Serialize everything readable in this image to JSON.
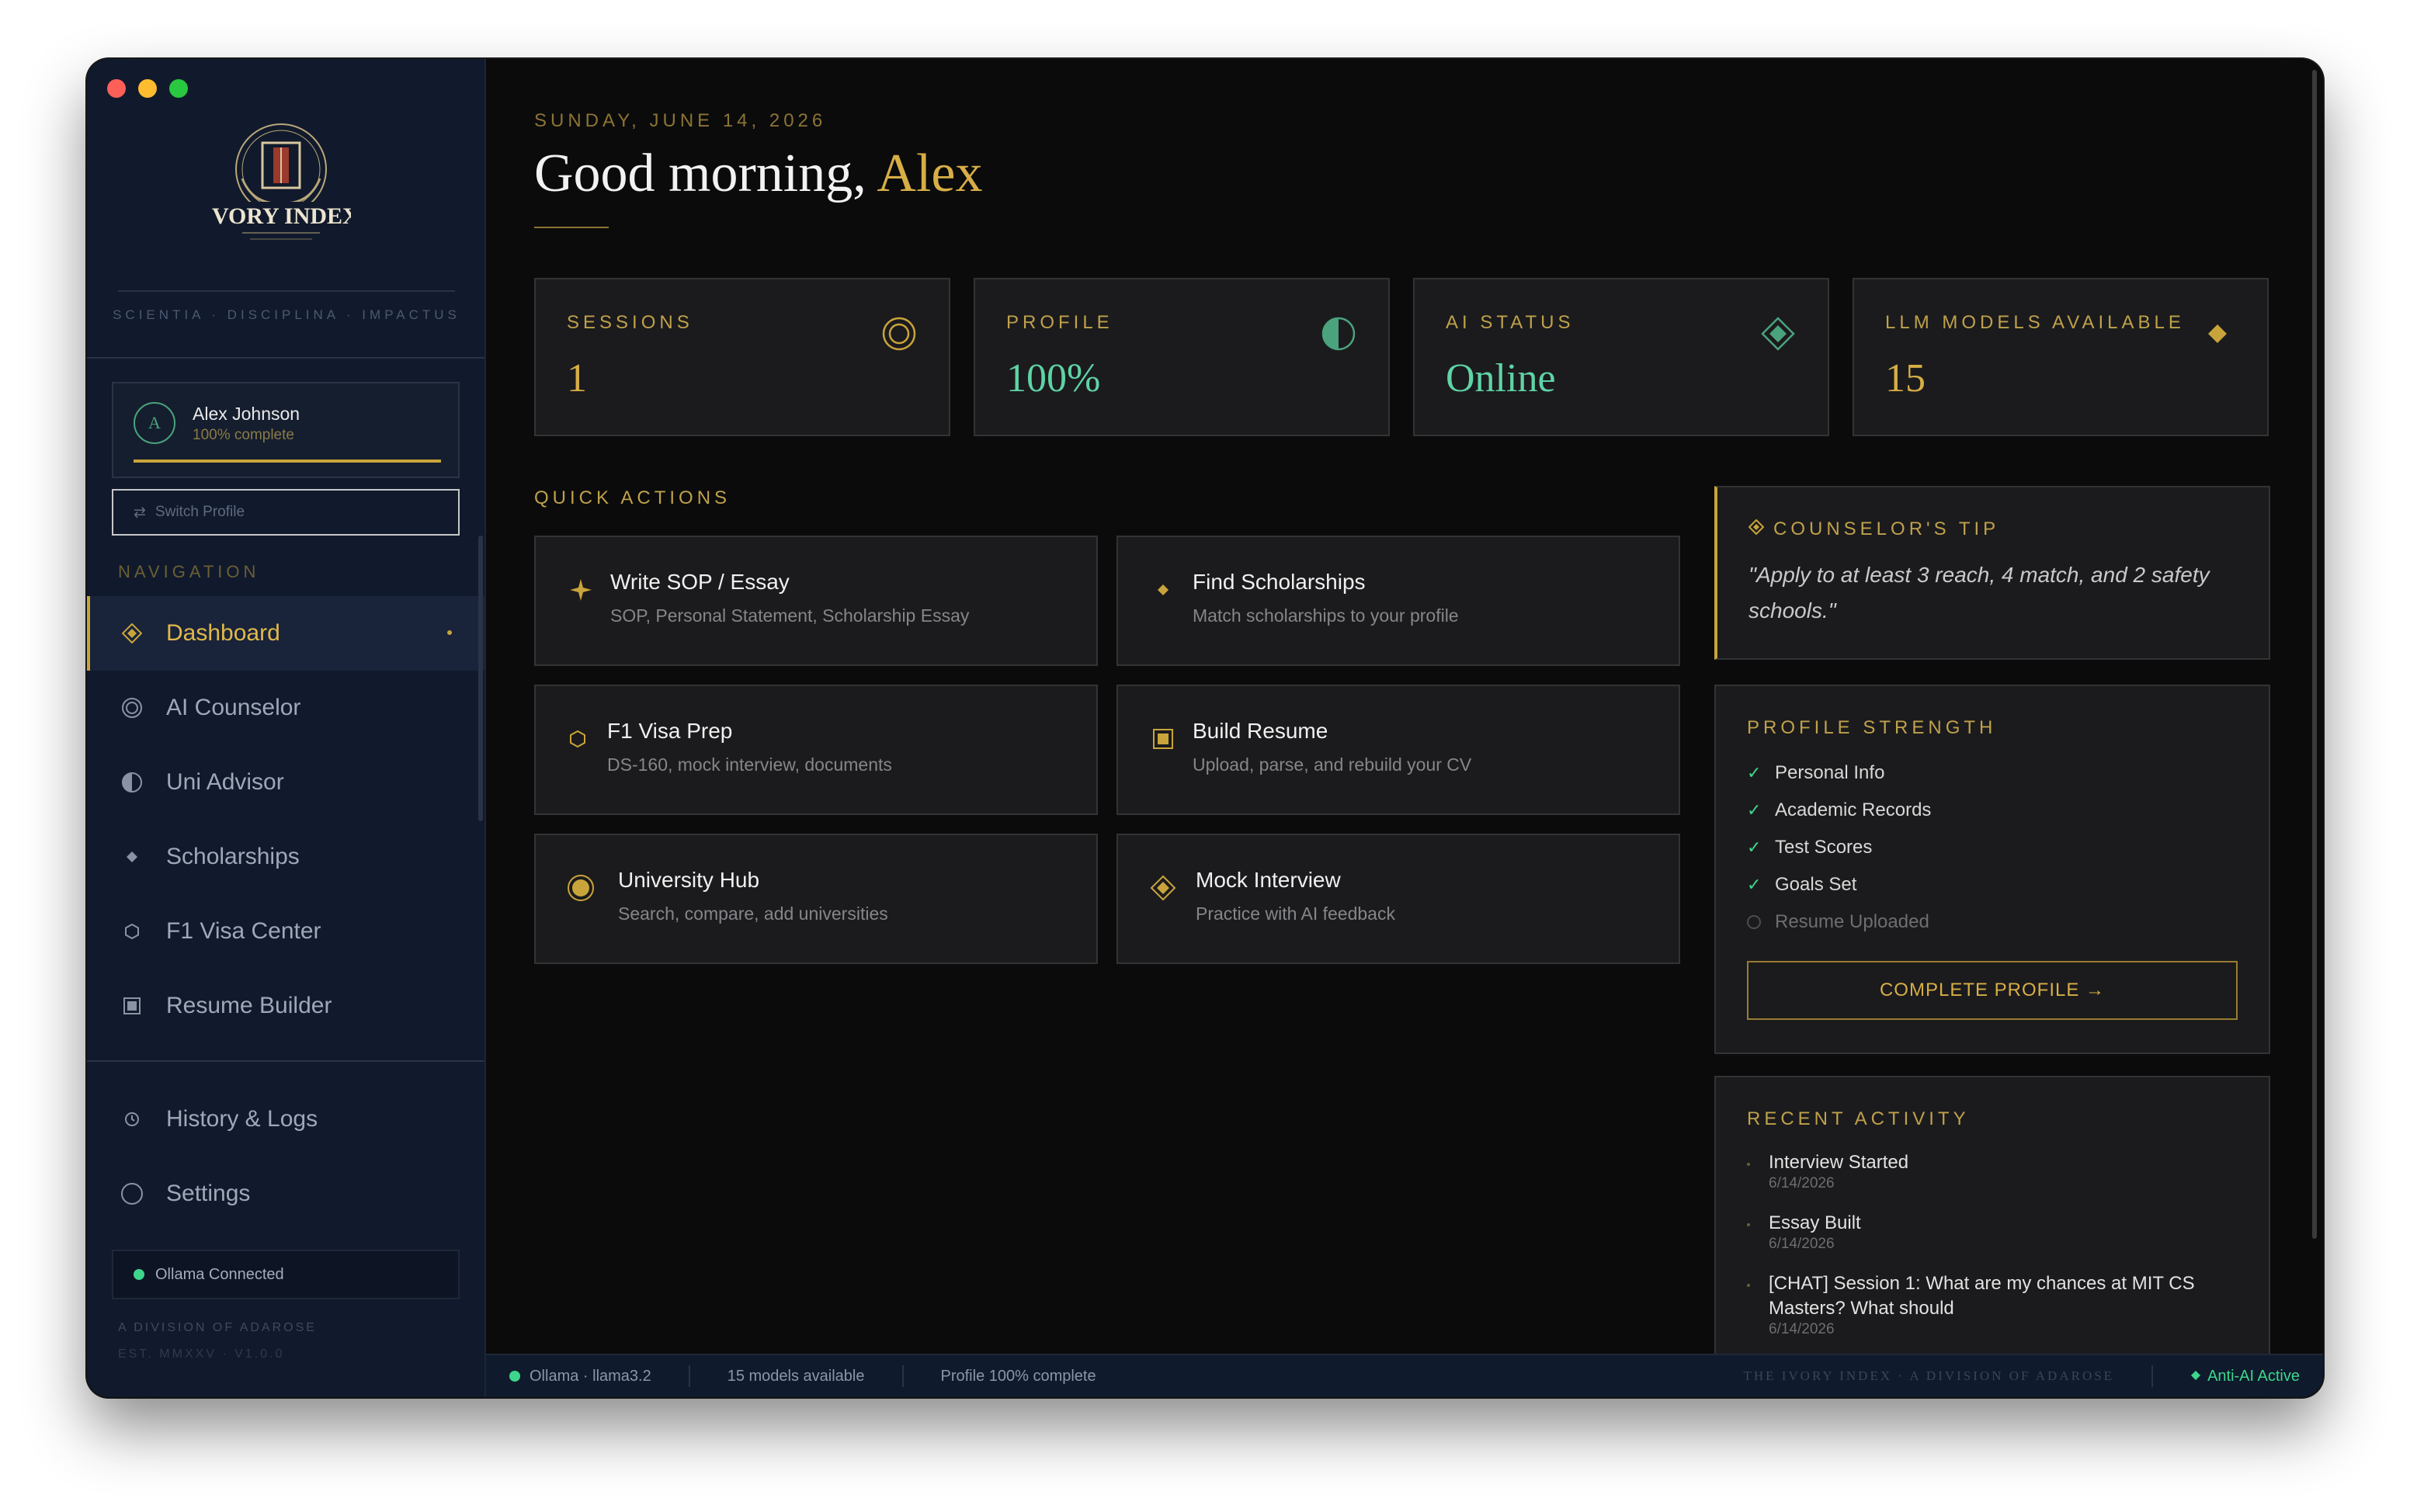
{
  "sidebar": {
    "motto": "SCIENTIA · DISCIPLINA · IMPACTUS",
    "profile": {
      "initial": "A",
      "name": "Alex Johnson",
      "progress_text": "100% complete",
      "progress": 1.0
    },
    "switch_profile": "Switch Profile",
    "nav_title": "NAVIGATION",
    "nav_items": [
      {
        "label": "Dashboard",
        "icon": "diamond-icon",
        "active": true
      },
      {
        "label": "AI Counselor",
        "icon": "ring-icon"
      },
      {
        "label": "Uni Advisor",
        "icon": "half-circle-icon"
      },
      {
        "label": "Scholarships",
        "icon": "small-diamond-icon"
      },
      {
        "label": "F1 Visa Center",
        "icon": "hexagon-icon"
      },
      {
        "label": "Resume Builder",
        "icon": "square-icon"
      }
    ],
    "bottom_items": [
      {
        "label": "History & Logs",
        "icon": "clock-icon"
      },
      {
        "label": "Settings",
        "icon": "circle-icon"
      }
    ],
    "ollama_status": "Ollama Connected",
    "division": "A DIVISION OF ADAROSE",
    "est": "EST. MMXXV · V1.0.0"
  },
  "header": {
    "date": "SUNDAY, JUNE 14, 2026",
    "greeting": "Good morning, ",
    "name": "Alex"
  },
  "stats": [
    {
      "label": "SESSIONS",
      "value": "1",
      "icon": "ring-icon"
    },
    {
      "label": "PROFILE",
      "value": "100%",
      "icon": "half-circle-icon"
    },
    {
      "label": "AI STATUS",
      "value": "Online",
      "icon": "diamond-icon"
    },
    {
      "label": "LLM MODELS AVAILABLE",
      "value": "15",
      "icon": "small-diamond-icon"
    }
  ],
  "quick_actions": {
    "title": "QUICK ACTIONS",
    "items": [
      {
        "name": "Write SOP / Essay",
        "desc": "SOP, Personal Statement, Scholarship Essay",
        "icon": "sparkle-icon"
      },
      {
        "name": "Find Scholarships",
        "desc": "Match scholarships to your profile",
        "icon": "small-diamond-icon"
      },
      {
        "name": "F1 Visa Prep",
        "desc": "DS-160, mock interview, documents",
        "icon": "hexagon-icon"
      },
      {
        "name": "Build Resume",
        "desc": "Upload, parse, and rebuild your CV",
        "icon": "square-icon"
      },
      {
        "name": "University Hub",
        "desc": "Search, compare, add universities",
        "icon": "ring-icon"
      },
      {
        "name": "Mock Interview",
        "desc": "Practice with AI feedback",
        "icon": "diamond-icon"
      }
    ]
  },
  "tip": {
    "title": "COUNSELOR'S TIP",
    "text": "\"Apply to at least 3 reach, 4 match, and 2 safety schools.\""
  },
  "profile_strength": {
    "title": "PROFILE STRENGTH",
    "items": [
      {
        "label": "Personal Info",
        "done": true
      },
      {
        "label": "Academic Records",
        "done": true
      },
      {
        "label": "Test Scores",
        "done": true
      },
      {
        "label": "Goals Set",
        "done": true
      },
      {
        "label": "Resume Uploaded",
        "done": false
      }
    ],
    "button": "COMPLETE PROFILE →"
  },
  "recent_activity": {
    "title": "RECENT ACTIVITY",
    "items": [
      {
        "title": "Interview Started",
        "date": "6/14/2026"
      },
      {
        "title": "Essay Built",
        "date": "6/14/2026"
      },
      {
        "title": "[CHAT] Session 1: What are my chances at MIT CS Masters? What should",
        "date": "6/14/2026"
      }
    ]
  },
  "statusbar": {
    "model": "Ollama · llama3.2",
    "models": "15 models available",
    "profile": "Profile 100% complete",
    "brand": "THE IVORY INDEX · A DIVISION OF ADAROSE",
    "anti_ai": "Anti-AI Active"
  },
  "colors": {
    "accent": "#c9a43a",
    "online": "#5fd3a6",
    "sidebar_bg": "#111a2c",
    "main_bg": "#0b0b0c"
  }
}
